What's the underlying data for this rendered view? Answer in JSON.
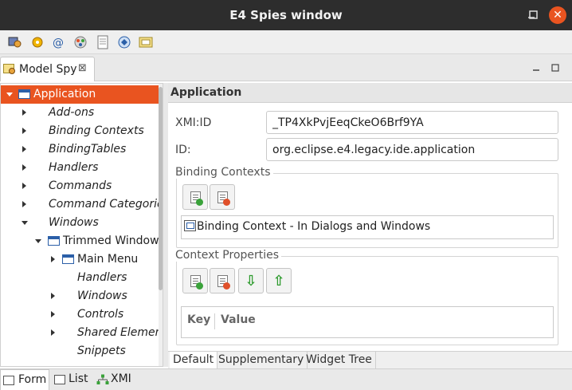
{
  "window": {
    "title": "E4 Spies window",
    "minimize_glyph": "",
    "close_glyph": "✕"
  },
  "toolbar": {
    "tools": [
      "model-spy-icon",
      "event-spy-icon",
      "context-spy-icon",
      "css-spy-icon",
      "preference-spy-icon",
      "extension-spy-icon",
      "bundle-spy-icon"
    ]
  },
  "view": {
    "tab_label": "Model Spy",
    "tab_close": "⊠"
  },
  "tree": {
    "items": [
      {
        "label": "Application",
        "italic": false,
        "selected": true,
        "expanded": true
      },
      {
        "label": "Add-ons",
        "italic": true
      },
      {
        "label": "Binding Contexts",
        "italic": true
      },
      {
        "label": "BindingTables",
        "italic": true
      },
      {
        "label": "Handlers",
        "italic": true
      },
      {
        "label": "Commands",
        "italic": true
      },
      {
        "label": "Command Categories",
        "italic": true
      },
      {
        "label": "Windows",
        "italic": true,
        "expanded": true
      },
      {
        "label": "Trimmed Window -",
        "italic": false,
        "expanded": true
      },
      {
        "label": "Main Menu",
        "italic": false
      },
      {
        "label": "Handlers",
        "italic": true
      },
      {
        "label": "Windows",
        "italic": true
      },
      {
        "label": "Controls",
        "italic": true
      },
      {
        "label": "Shared Elements",
        "italic": true
      },
      {
        "label": "Snippets",
        "italic": true
      }
    ]
  },
  "detail": {
    "header": "Application",
    "xmi_label": "XMI:ID",
    "xmi_value": "_TP4XkPvjEeqCkeO6Brf9YA",
    "id_label": "ID:",
    "id_value": "org.eclipse.e4.legacy.ide.application",
    "binding_contexts": {
      "title": "Binding Contexts",
      "items": [
        "Binding Context - In Dialogs and Windows"
      ]
    },
    "context_properties": {
      "title": "Context Properties",
      "up_glyph": "⇩",
      "down_glyph": "⇧",
      "col_key": "Key",
      "col_value": "Value"
    }
  },
  "subtabs": [
    "Default",
    "Supplementary",
    "Widget Tree"
  ],
  "bottom_tabs": [
    "Form",
    "List",
    "XMI"
  ],
  "colors": {
    "accent": "#e95420",
    "titlebar": "#2d2d2d"
  }
}
